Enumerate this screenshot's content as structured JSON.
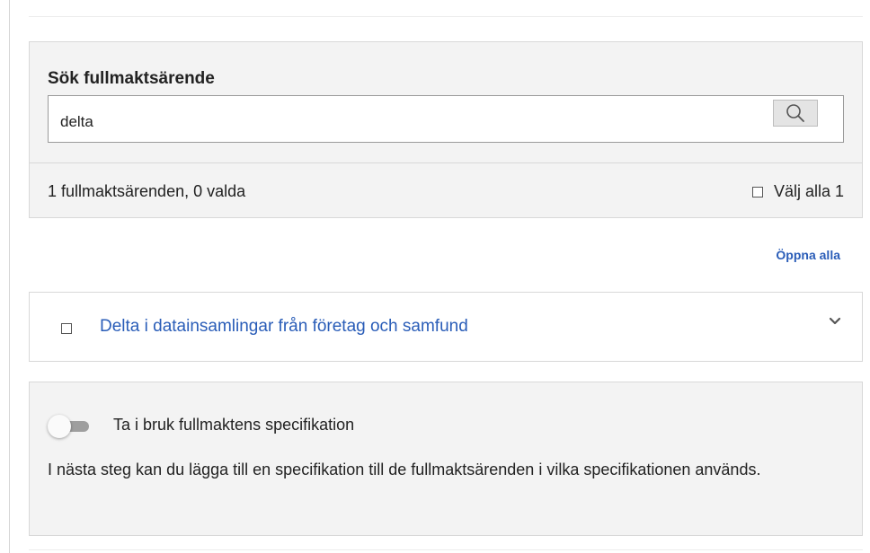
{
  "search": {
    "label": "Sök fullmaktsärende",
    "value": "delta",
    "button_icon": "search-icon"
  },
  "results": {
    "count_text": "1 fullmaktsärenden, 0 valda",
    "select_all_label": "Välj alla 1",
    "select_all_checked": false,
    "open_all_label": "Öppna alla",
    "items": [
      {
        "label": "Delta i datainsamlingar från företag och samfund",
        "checked": false,
        "expand_icon": "chevron-down-icon"
      }
    ]
  },
  "specification": {
    "toggle_label": "Ta i bruk fullmaktens specifikation",
    "toggle_on": false,
    "description": "I nästa steg kan du lägga till en specifikation till de fullmaktsärenden i vilka specifikationen används."
  },
  "colors": {
    "link": "#2a5db8",
    "panel_background": "#f3f3f3",
    "border": "#d8d8d8"
  }
}
